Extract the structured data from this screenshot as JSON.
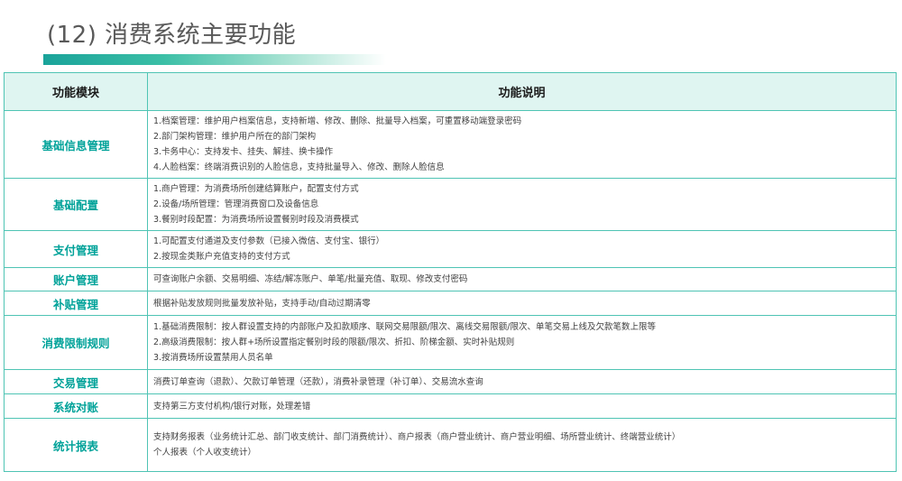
{
  "title": "(12) 消费系统主要功能",
  "headers": {
    "module": "功能模块",
    "description": "功能说明"
  },
  "rows": [
    {
      "module": "基础信息管理",
      "lines": [
        "1.档案管理：维护用户档案信息，支持新增、修改、删除、批量导入档案，可重置移动端登录密码",
        "2.部门架构管理：维护用户所在的部门架构",
        "3.卡务中心：支持发卡、挂失、解挂、换卡操作",
        "4.人脸档案：终端消费识别的人脸信息，支持批量导入、修改、删除人脸信息"
      ]
    },
    {
      "module": "基础配置",
      "lines": [
        "1.商户管理：为消费场所创建结算账户，配置支付方式",
        "2.设备/场所管理：管理消费窗口及设备信息",
        "3.餐别时段配置：为消费场所设置餐别时段及消费模式"
      ]
    },
    {
      "module": "支付管理",
      "lines": [
        "1.可配置支付通道及支付参数（已接入微信、支付宝、银行）",
        "2.按现金类账户充值支持的支付方式"
      ]
    },
    {
      "module": "账户管理",
      "lines": [
        "可查询账户余额、交易明细、冻结/解冻账户、单笔/批量充值、取现、修改支付密码"
      ]
    },
    {
      "module": "补贴管理",
      "lines": [
        "根据补贴发放规则批量发放补贴，支持手动/自动过期清零"
      ]
    },
    {
      "module": "消费限制规则",
      "lines": [
        "1.基础消费限制：按人群设置支持的内部账户及扣款顺序、联网交易限额/限次、离线交易限额/限次、单笔交易上线及欠款笔数上限等",
        "2.高级消费限制：按人群+场所设置指定餐别时段的限额/限次、折扣、阶梯金额、实时补贴规则",
        "3.按消费场所设置禁用人员名单"
      ]
    },
    {
      "module": "交易管理",
      "lines": [
        "消费订单查询（退款）、欠款订单管理（还款），消费补录管理（补订单）、交易流水查询"
      ]
    },
    {
      "module": "系统对账",
      "lines": [
        "支持第三方支付机构/银行对账，处理差错"
      ]
    },
    {
      "module": "统计报表",
      "lines": [
        "支持财务报表（业务统计汇总、部门收支统计、部门消费统计）、商户报表（商户营业统计、商户营业明细、场所营业统计、终端营业统计）",
        "个人报表（个人收支统计）"
      ]
    }
  ],
  "colors": {
    "accent": "#00a299",
    "header_bg": "#dff5f1",
    "border": "#4fc4b4",
    "title": "#595959"
  }
}
